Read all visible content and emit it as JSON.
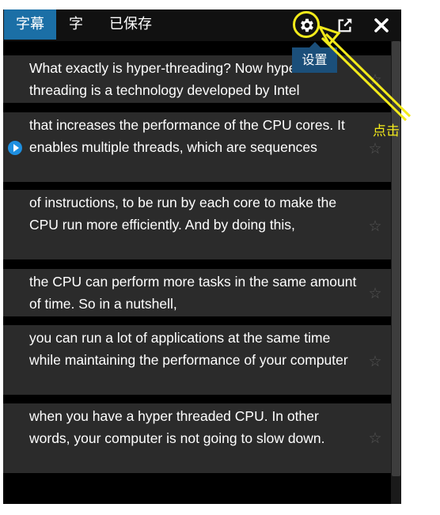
{
  "tabs": [
    {
      "label": "字幕",
      "active": true
    },
    {
      "label": "字"
    },
    {
      "label": "已保存"
    }
  ],
  "toolbar": {
    "settings_tooltip": "设置",
    "icons": [
      "gear-icon",
      "share-icon",
      "close-icon"
    ]
  },
  "subtitles": [
    {
      "text": "What exactly is hyper-threading? Now hyper-threading is a technology developed by Intel"
    },
    {
      "text": "that increases the performance of the CPU cores. It enables multiple threads, which are sequences",
      "playing": true
    },
    {
      "text": "of instructions, to be run by each core to make the CPU run more efficiently. And by doing this,"
    },
    {
      "text": "the CPU can perform more tasks in the  same amount of time. So in a nutshell,"
    },
    {
      "text": "you can run a lot of applications at the same time  while maintaining the performance of your computer"
    },
    {
      "text": "when you have a hyper threaded CPU. In other words, your computer is not going to slow down."
    }
  ],
  "annotation": {
    "label": "点击"
  },
  "colors": {
    "accent": "#1b6fa6",
    "annotation": "#f2ea1a",
    "row_bg": "#2b2b2b",
    "play": "#1e8fe0"
  }
}
